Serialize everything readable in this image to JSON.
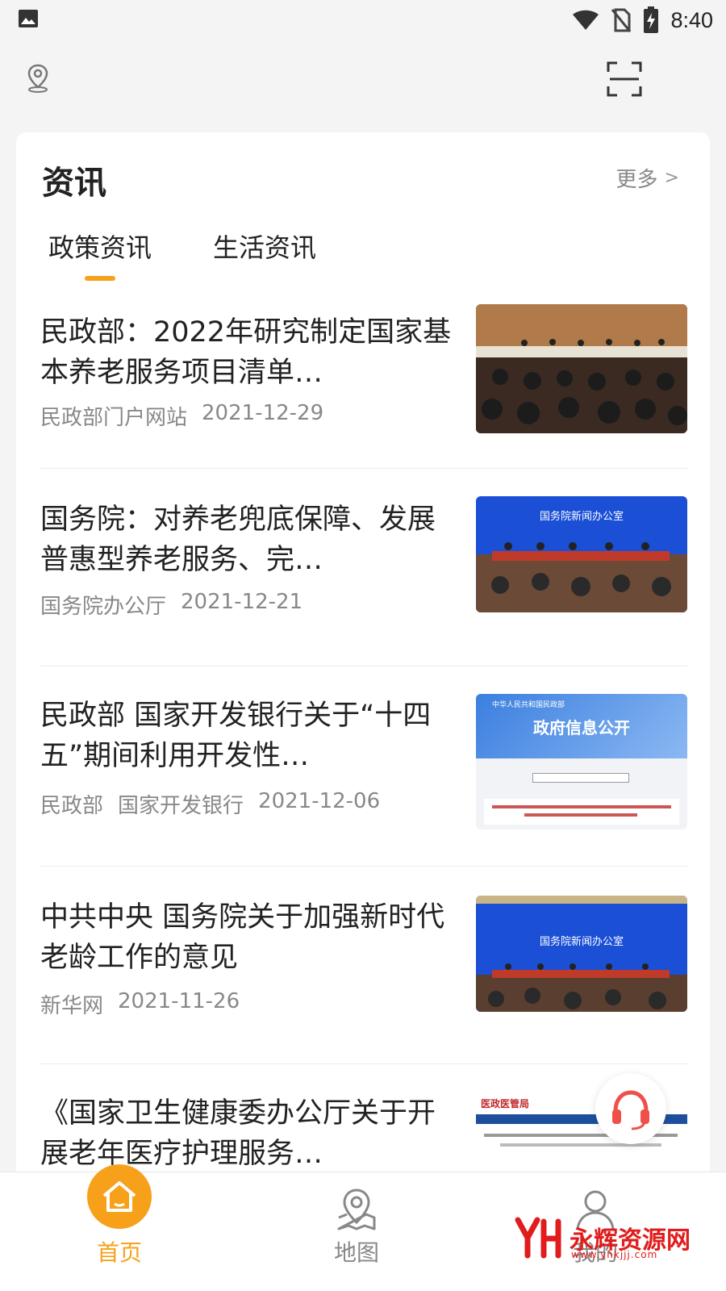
{
  "status_bar": {
    "time": "8:40"
  },
  "section": {
    "title": "资讯",
    "more_label": "更多",
    "more_arrow": ">"
  },
  "tabs": [
    {
      "label": "政策资讯",
      "active": true
    },
    {
      "label": "生活资讯",
      "active": false
    }
  ],
  "news": [
    {
      "title": "民政部：2022年研究制定国家基本养老服务项目清单…",
      "sources": [
        "民政部门户网站"
      ],
      "date": "2021-12-29"
    },
    {
      "title": "国务院：对养老兜底保障、发展普惠型养老服务、完…",
      "sources": [
        "国务院办公厅"
      ],
      "date": "2021-12-21",
      "thumb_caption": "国务院新闻办公室"
    },
    {
      "title": "民政部 国家开发银行关于“十四五”期间利用开发性…",
      "sources": [
        "民政部",
        "国家开发银行"
      ],
      "date": "2021-12-06",
      "thumb_header": "中华人民共和国民政部",
      "thumb_banner": "政府信息公开"
    },
    {
      "title": "中共中央 国务院关于加强新时代老龄工作的意见",
      "sources": [
        "新华网"
      ],
      "date": "2021-11-26",
      "thumb_caption": "国务院新闻办公室"
    },
    {
      "title": "《国家卫生健康委办公厅关于开展老年医疗护理服务…",
      "sources": [],
      "date": "",
      "thumb_header": "医政医管局"
    }
  ],
  "bottom_nav": [
    {
      "label": "首页",
      "icon": "home-icon",
      "active": true
    },
    {
      "label": "地图",
      "icon": "map-pin-icon",
      "active": false
    },
    {
      "label": "我的",
      "icon": "user-icon",
      "active": false
    }
  ],
  "watermark": {
    "text": "永辉资源网",
    "url": "www.yhkjjj.com"
  },
  "colors": {
    "accent": "#f7a11b",
    "muted": "#888888",
    "support": "#f0504a"
  }
}
